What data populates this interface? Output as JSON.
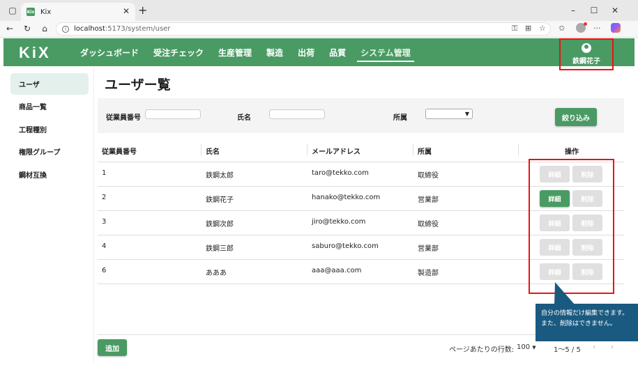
{
  "browser": {
    "tab_title": "Kix",
    "tab_favicon_text": "Kix",
    "url_host": "localhost",
    "url_path": ":5173/system/user"
  },
  "header": {
    "logo": "KiX",
    "nav": [
      "ダッシュボード",
      "受注チェック",
      "生産管理",
      "製造",
      "出荷",
      "品質",
      "システム管理"
    ],
    "active_nav": "システム管理",
    "user_name": "鉄鋼花子"
  },
  "sidebar": {
    "items": [
      "ユーザ",
      "商品一覧",
      "工程種別",
      "権限グループ",
      "鋼材互換"
    ]
  },
  "main": {
    "title": "ユーザー覧",
    "filter": {
      "employee_no_label": "従業員番号",
      "name_label": "氏名",
      "dept_label": "所属",
      "dept_value": "",
      "submit_label": "絞り込み"
    },
    "table": {
      "headers": [
        "従業員番号",
        "氏名",
        "メールアドレス",
        "所属",
        "操作"
      ],
      "rows": [
        {
          "id": "1",
          "name": "鉄鋼太郎",
          "email": "taro@tekko.com",
          "dept": "取締役",
          "enabled": false
        },
        {
          "id": "2",
          "name": "鉄鋼花子",
          "email": "hanako@tekko.com",
          "dept": "営業部",
          "enabled": true
        },
        {
          "id": "3",
          "name": "鉄鋼次郎",
          "email": "jiro@tekko.com",
          "dept": "取締役",
          "enabled": false
        },
        {
          "id": "4",
          "name": "鉄鋼三郎",
          "email": "saburo@tekko.com",
          "dept": "営業部",
          "enabled": false
        },
        {
          "id": "6",
          "name": "あああ",
          "email": "aaa@aaa.com",
          "dept": "製造部",
          "enabled": false
        }
      ],
      "detail_label": "詳細",
      "delete_label": "削除"
    },
    "add_label": "追加",
    "pager": {
      "rows_per_page_label": "ページあたりの行数:",
      "rows_per_page_value": "100",
      "range": "1〜5 / 5"
    }
  },
  "callout": {
    "line1": "自分の情報だけ編集できます。",
    "line2": "また、削除はできません。"
  },
  "colors": {
    "brand": "#4a9a64",
    "highlight": "#e11111",
    "callout": "#1a5a80"
  }
}
